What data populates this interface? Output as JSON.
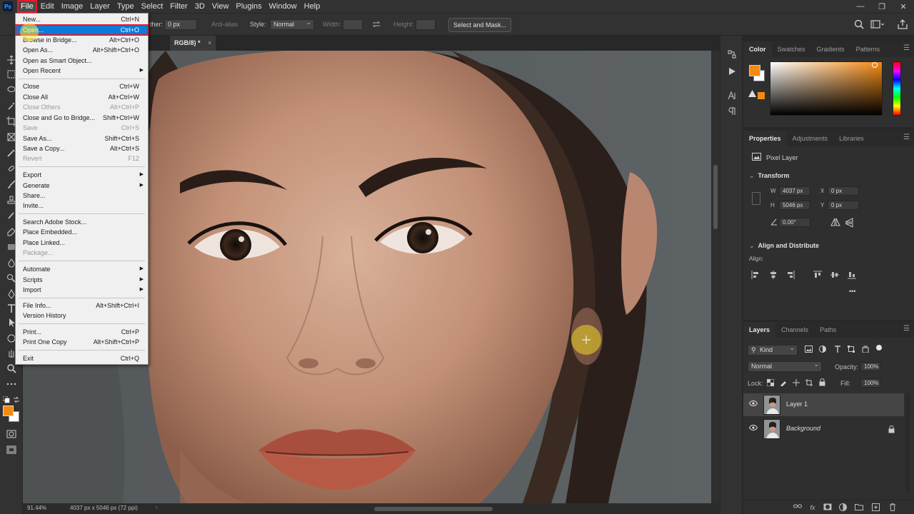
{
  "menubar": {
    "app_logo": "Ps",
    "items": [
      "File",
      "Edit",
      "Image",
      "Layer",
      "Type",
      "Select",
      "Filter",
      "3D",
      "View",
      "Plugins",
      "Window",
      "Help"
    ]
  },
  "options_bar": {
    "feather_label": "ther:",
    "feather_value": "0 px",
    "antialias_label": "Anti-alias",
    "style_label": "Style:",
    "style_value": "Normal",
    "width_label": "Width:",
    "height_label": "Height:",
    "mask_button": "Select and Mask..."
  },
  "document": {
    "tab_title": "RGB/8) *",
    "tab_close": "×",
    "zoom": "91.44%",
    "info": "4037 px x 5046 px (72 ppi)",
    "status_arrow": "›"
  },
  "file_menu": {
    "items": [
      {
        "label": "New...",
        "shortcut": "Ctrl+N"
      },
      {
        "label": "Open...",
        "shortcut": "Ctrl+O",
        "highlighted": true
      },
      {
        "label": "Browse in Bridge...",
        "shortcut": "Alt+Ctrl+O"
      },
      {
        "label": "Open As...",
        "shortcut": "Alt+Shift+Ctrl+O"
      },
      {
        "label": "Open as Smart Object..."
      },
      {
        "label": "Open Recent",
        "submenu": true
      },
      {
        "label": "Close",
        "shortcut": "Ctrl+W"
      },
      {
        "label": "Close All",
        "shortcut": "Alt+Ctrl+W"
      },
      {
        "label": "Close Others",
        "shortcut": "Alt+Ctrl+P",
        "disabled": true
      },
      {
        "label": "Close and Go to Bridge...",
        "shortcut": "Shift+Ctrl+W"
      },
      {
        "label": "Save",
        "shortcut": "Ctrl+S",
        "disabled": true
      },
      {
        "label": "Save As...",
        "shortcut": "Shift+Ctrl+S"
      },
      {
        "label": "Save a Copy...",
        "shortcut": "Alt+Ctrl+S"
      },
      {
        "label": "Revert",
        "shortcut": "F12",
        "disabled": true
      },
      {
        "label": "Export",
        "submenu": true
      },
      {
        "label": "Generate",
        "submenu": true
      },
      {
        "label": "Share..."
      },
      {
        "label": "Invite..."
      },
      {
        "label": "Search Adobe Stock..."
      },
      {
        "label": "Place Embedded..."
      },
      {
        "label": "Place Linked..."
      },
      {
        "label": "Package...",
        "disabled": true
      },
      {
        "label": "Automate",
        "submenu": true
      },
      {
        "label": "Scripts",
        "submenu": true
      },
      {
        "label": "Import",
        "submenu": true
      },
      {
        "label": "File Info...",
        "shortcut": "Alt+Shift+Ctrl+I"
      },
      {
        "label": "Version History"
      },
      {
        "label": "Print...",
        "shortcut": "Ctrl+P"
      },
      {
        "label": "Print One Copy",
        "shortcut": "Alt+Shift+Ctrl+P"
      },
      {
        "label": "Exit",
        "shortcut": "Ctrl+Q"
      }
    ]
  },
  "color_panel": {
    "tabs": [
      "Color",
      "Swatches",
      "Gradients",
      "Patterns"
    ],
    "foreground": "#f48a12",
    "background": "#ffffff"
  },
  "properties_panel": {
    "tabs": [
      "Properties",
      "Adjustments",
      "Libraries"
    ],
    "layer_type": "Pixel Layer",
    "transform_title": "Transform",
    "w_label": "W",
    "w_value": "4037 px",
    "h_label": "H",
    "h_value": "5046 px",
    "x_label": "X",
    "x_value": "0 px",
    "y_label": "Y",
    "y_value": "0 px",
    "angle_value": "0.00°",
    "align_title": "Align and Distribute",
    "align_label": "Align:",
    "more": "•••"
  },
  "layers_panel": {
    "tabs": [
      "Layers",
      "Channels",
      "Paths"
    ],
    "filter_kind": "Kind",
    "blend_mode": "Normal",
    "opacity_label": "Opacity:",
    "opacity_value": "100%",
    "lock_label": "Lock:",
    "fill_label": "Fill:",
    "fill_value": "100%",
    "layers": [
      {
        "name": "Layer 1",
        "selected": true
      },
      {
        "name": "Background",
        "locked": true
      }
    ]
  },
  "colors": {
    "accent_highlight": "#0a7bd8",
    "annotation_red": "#e8192c",
    "foreground_orange": "#f48a12"
  }
}
